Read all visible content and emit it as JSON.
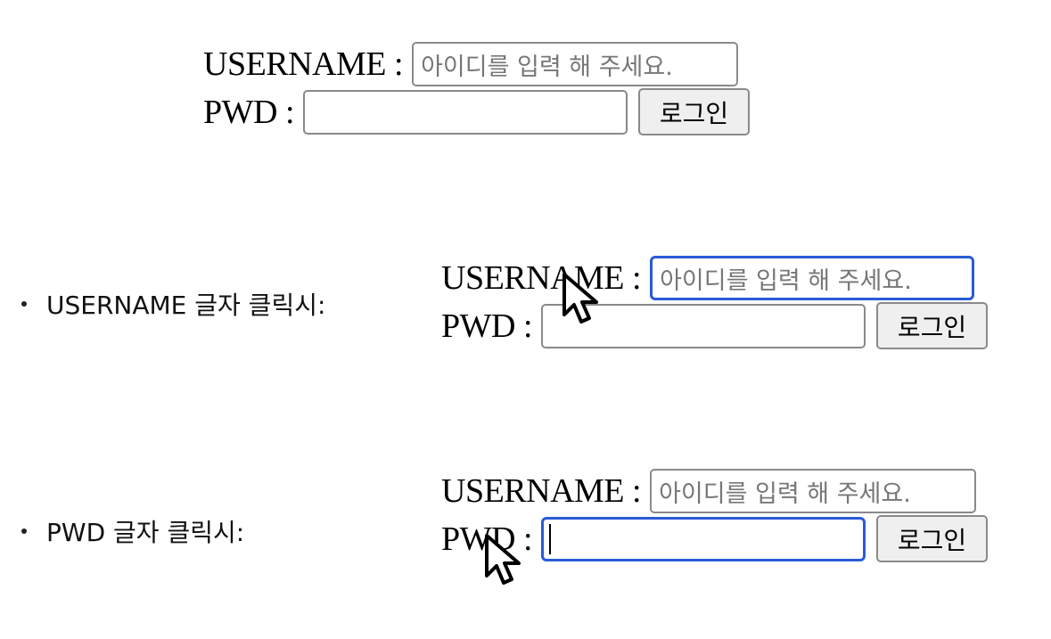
{
  "forms": [
    {
      "username_label": "USERNAME :",
      "username_placeholder": "아이디를 입력 해 주세요.",
      "pwd_label": "PWD :",
      "pwd_value": "",
      "login_label": "로그인",
      "focused": "none"
    },
    {
      "username_label": "USERNAME :",
      "username_placeholder": "아이디를 입력 해 주세요.",
      "pwd_label": "PWD :",
      "pwd_value": "",
      "login_label": "로그인",
      "focused": "username"
    },
    {
      "username_label": "USERNAME :",
      "username_placeholder": "아이디를 입력 해 주세요.",
      "pwd_label": "PWD :",
      "pwd_value": "",
      "login_label": "로그인",
      "focused": "pwd"
    }
  ],
  "notes": [
    "USERNAME 글자 클릭시:",
    "PWD 글자 클릭시:"
  ],
  "colors": {
    "focus_ring": "#2a5bd7",
    "input_border": "#8a8a8a",
    "button_bg": "#efefef",
    "placeholder": "#777777"
  },
  "icons": [
    "mouse-pointer-icon"
  ]
}
